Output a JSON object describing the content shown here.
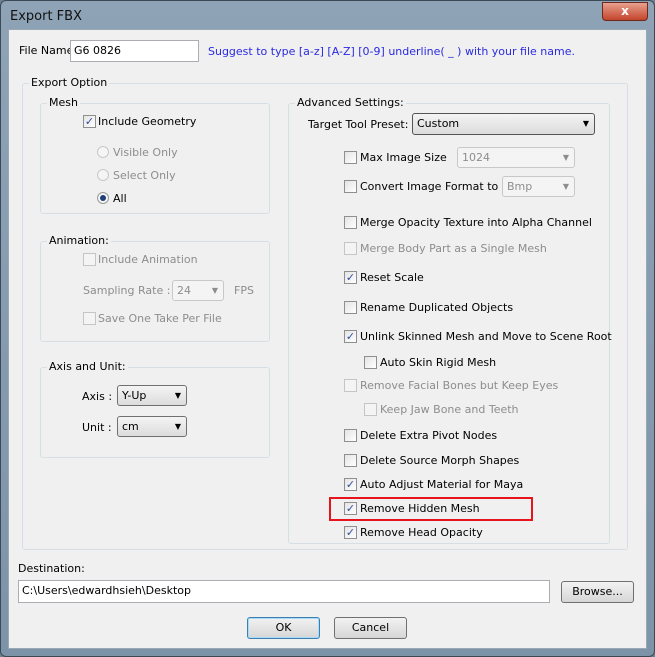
{
  "window": {
    "title": "Export FBX",
    "close_label": "x"
  },
  "file_name": {
    "label": "File Name:",
    "value": "G6 0826",
    "hint": "Suggest to type [a-z] [A-Z] [0-9] underline( _ ) with your file name.",
    "hint_color": "#2a2ae0"
  },
  "export_option": {
    "label": "Export Option"
  },
  "mesh": {
    "label": "Mesh",
    "include_geometry": {
      "label": "Include Geometry",
      "checked": true
    },
    "radios": [
      {
        "label": "Visible Only",
        "selected": false,
        "disabled": true
      },
      {
        "label": "Select Only",
        "selected": false,
        "disabled": true
      },
      {
        "label": "All",
        "selected": true,
        "disabled": false
      }
    ]
  },
  "animation": {
    "label": "Animation:",
    "include_animation": {
      "label": "Include Animation",
      "checked": false,
      "disabled": true
    },
    "sampling_rate_label": "Sampling Rate :",
    "sampling_rate": "24",
    "fps_label": "FPS",
    "save_one_take": {
      "label": "Save One Take Per File",
      "checked": false,
      "disabled": true
    }
  },
  "axis_unit": {
    "label": "Axis and Unit:",
    "axis_label": "Axis :",
    "axis": "Y-Up",
    "unit_label": "Unit :",
    "unit": "cm"
  },
  "advanced": {
    "label": "Advanced Settings:",
    "preset_label": "Target Tool Preset:",
    "preset": "Custom",
    "max_image_size": "1024",
    "image_format": "Bmp",
    "options": [
      {
        "label": "Max Image Size",
        "checked": false,
        "disabled": false
      },
      {
        "label": "Convert Image Format to",
        "checked": false,
        "disabled": false
      },
      {
        "label": "Merge Opacity Texture into Alpha Channel",
        "checked": false,
        "disabled": false
      },
      {
        "label": "Merge Body Part as a Single Mesh",
        "checked": false,
        "disabled": true
      },
      {
        "label": "Reset Scale",
        "checked": true,
        "disabled": false
      },
      {
        "label": "Rename Duplicated Objects",
        "checked": false,
        "disabled": false
      },
      {
        "label": "Unlink Skinned Mesh and Move to Scene Root",
        "checked": true,
        "disabled": false
      },
      {
        "label": "Auto Skin Rigid Mesh",
        "checked": false,
        "disabled": false
      },
      {
        "label": "Remove Facial Bones but Keep Eyes",
        "checked": false,
        "disabled": true
      },
      {
        "label": "Keep Jaw Bone and Teeth",
        "checked": false,
        "disabled": true
      },
      {
        "label": "Delete Extra Pivot Nodes",
        "checked": false,
        "disabled": false
      },
      {
        "label": "Delete Source Morph Shapes",
        "checked": false,
        "disabled": false
      },
      {
        "label": "Auto Adjust Material for Maya",
        "checked": true,
        "disabled": false
      },
      {
        "label": "Remove Hidden Mesh",
        "checked": true,
        "disabled": false,
        "highlighted": true
      },
      {
        "label": "Remove Head Opacity",
        "checked": true,
        "disabled": false
      }
    ],
    "highlight_color": "#e8141c"
  },
  "destination": {
    "label": "Destination:",
    "value": "C:\\Users\\edwardhsieh\\Desktop",
    "browse_label": "Browse..."
  },
  "buttons": {
    "ok": "OK",
    "cancel": "Cancel"
  }
}
